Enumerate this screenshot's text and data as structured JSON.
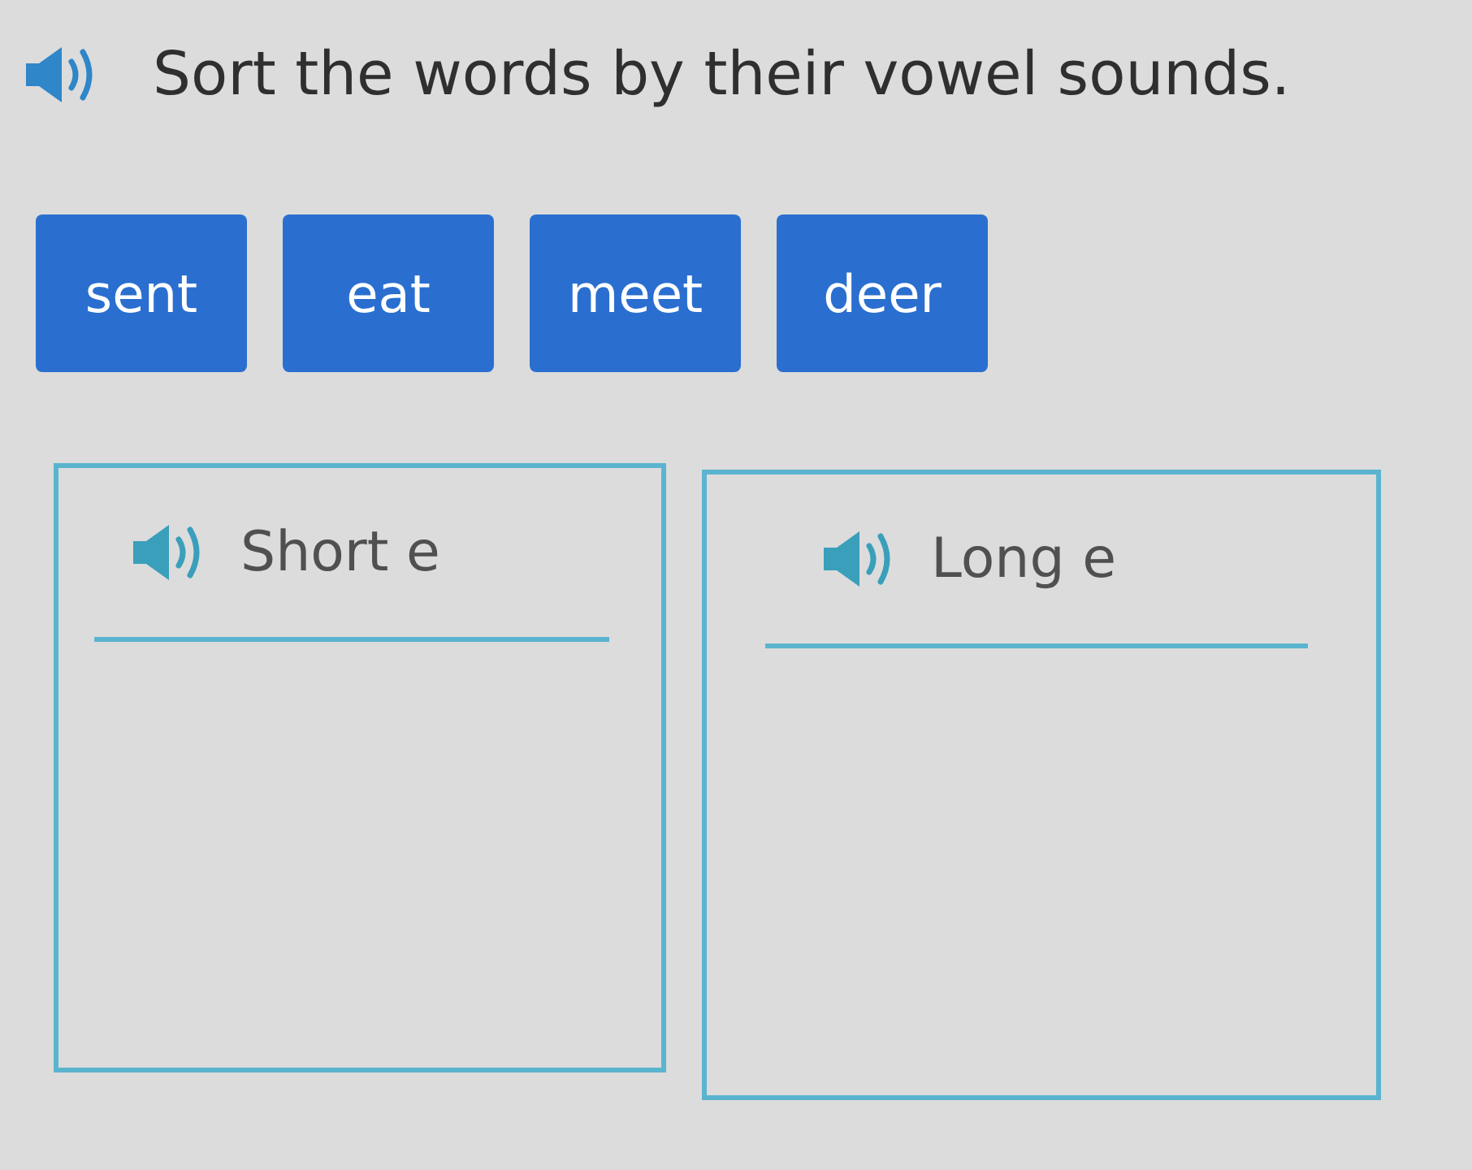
{
  "instruction": {
    "text": "Sort the words by their vowel sounds."
  },
  "tiles": [
    {
      "word": "sent"
    },
    {
      "word": "eat"
    },
    {
      "word": "meet"
    },
    {
      "word": "deer"
    }
  ],
  "bins": [
    {
      "label": "Short e"
    },
    {
      "label": "Long e"
    }
  ]
}
